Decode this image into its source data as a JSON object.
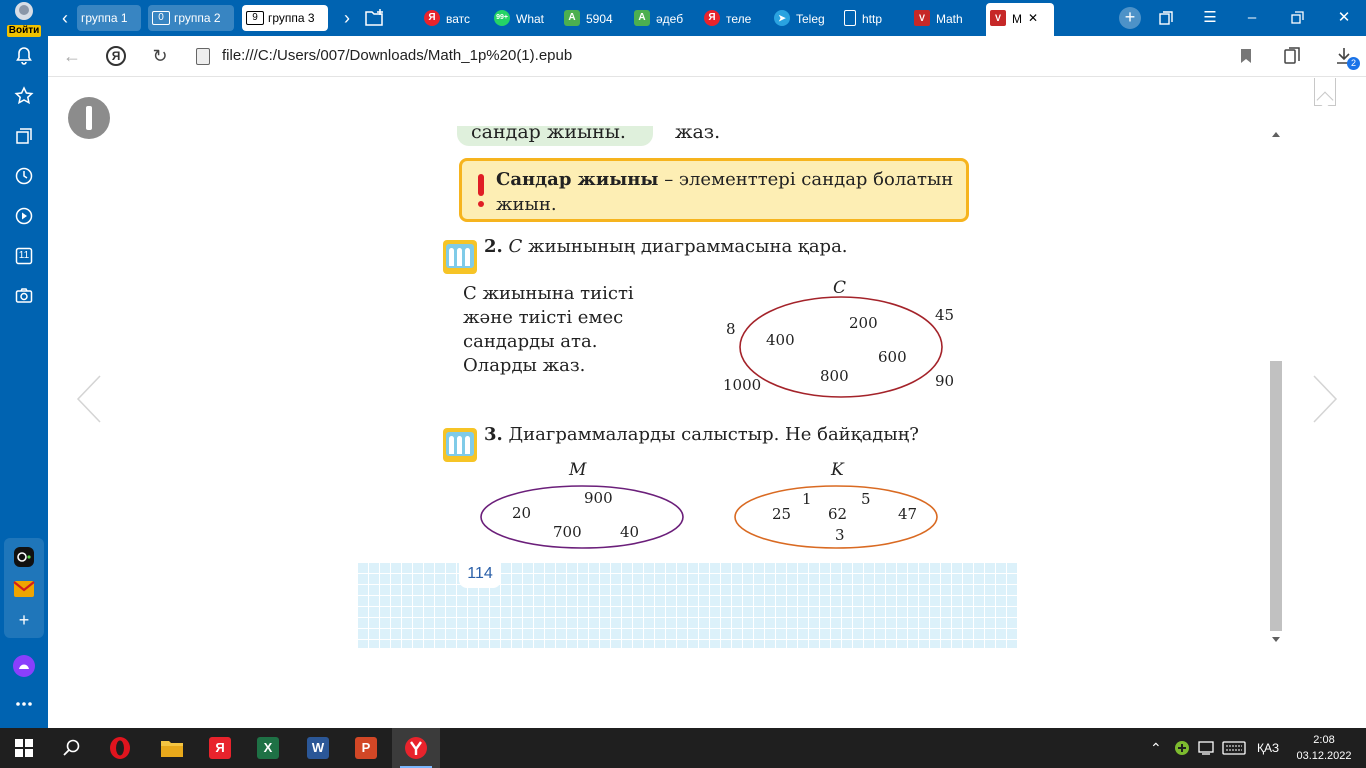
{
  "sidebar": {
    "login_label": "Войти",
    "badge_days": "11"
  },
  "tabbar": {
    "groups": [
      {
        "count": "",
        "label": "группа 1"
      },
      {
        "count": "0",
        "label": "группа 2"
      },
      {
        "count": "9",
        "label": "группа 3"
      }
    ],
    "tabs": [
      {
        "label": "ватс",
        "icon": "yandex-icon",
        "color": "#e8232c",
        "glyph": "Я"
      },
      {
        "label": "What",
        "icon": "whatsapp-icon",
        "color": "#25d366",
        "glyph": "99+"
      },
      {
        "label": "5904",
        "icon": "green-a-icon",
        "color": "#4caf50",
        "glyph": "A"
      },
      {
        "label": "әдеб",
        "icon": "green-a-icon",
        "color": "#4caf50",
        "glyph": "A"
      },
      {
        "label": "теле",
        "icon": "yandex-icon",
        "color": "#e8232c",
        "glyph": "Я"
      },
      {
        "label": "Teleg",
        "icon": "telegram-icon",
        "color": "#2aa3e0",
        "glyph": "➤"
      },
      {
        "label": "http",
        "icon": "page-icon",
        "color": "#ffffff",
        "glyph": ""
      },
      {
        "label": "Math",
        "icon": "book-icon",
        "color": "#c62828",
        "glyph": "V"
      },
      {
        "label": "M",
        "icon": "book-icon",
        "color": "#c62828",
        "glyph": "V"
      }
    ]
  },
  "address": {
    "url": "file:///C:/Users/007/Downloads/Math_1p%20(1).epub",
    "download_count": "2"
  },
  "page": {
    "top_left_text": "сандар жиыны.",
    "top_right_text": "жаз.",
    "rule_bold": "Сандар жиыны",
    "rule_rest": " – элементтері сандар болатын",
    "rule_line2": "жиын.",
    "task2": {
      "number": "2.",
      "set_letter": "C",
      "text": " жиынының диаграммасына қара.",
      "lines": [
        "C жиынына тиісті",
        "және тиісті емес",
        "сандарды ата.",
        "Оларды жаз."
      ]
    },
    "task3": {
      "number": "3.",
      "text": "Диаграммаларды салыстыр. Не байқадың?"
    },
    "page_number": "114"
  },
  "diagrams": {
    "C": {
      "label": "C",
      "inside": [
        "200",
        "400",
        "600",
        "800"
      ],
      "outside": [
        "8",
        "45",
        "1000",
        "90"
      ],
      "color": "#a4232a"
    },
    "M": {
      "label": "M",
      "inside": [
        "900",
        "20",
        "700",
        "40"
      ],
      "color": "#6b1f7a"
    },
    "K": {
      "label": "K",
      "inside": [
        "1",
        "5",
        "25",
        "62",
        "47",
        "3"
      ],
      "color": "#d96a22"
    }
  },
  "taskbar": {
    "lang": "ҚАЗ",
    "time": "2:08",
    "date": "03.12.2022"
  }
}
